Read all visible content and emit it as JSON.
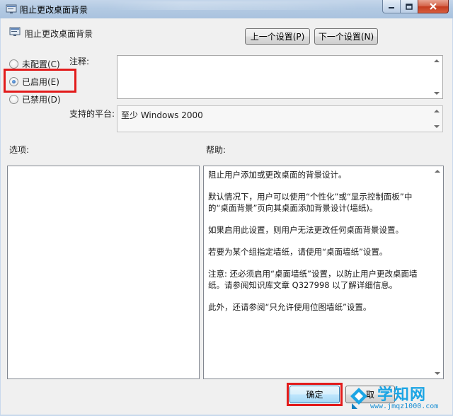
{
  "window": {
    "title": "阻止更改桌面背景",
    "controls": [
      "minimize",
      "maximize",
      "close"
    ]
  },
  "header": {
    "setting_name": "阻止更改桌面背景",
    "prev_button": "上一个设置(P)",
    "next_button": "下一个设置(N)"
  },
  "state": {
    "options": [
      {
        "label": "未配置(C)",
        "checked": false
      },
      {
        "label": "已启用(E)",
        "checked": true
      },
      {
        "label": "已禁用(D)",
        "checked": false
      }
    ]
  },
  "comment": {
    "label": "注释:",
    "value": ""
  },
  "platform": {
    "label": "支持的平台:",
    "value": "至少 Windows 2000"
  },
  "options_section": {
    "label": "选项:"
  },
  "help_section": {
    "label": "帮助:",
    "paragraphs": [
      "阻止用户添加或更改桌面的背景设计。",
      "默认情况下，用户可以使用“个性化”或“显示控制面板”中的“桌面背景”页向其桌面添加背景设计(墙纸)。",
      "如果启用此设置，则用户无法更改任何桌面背景设置。",
      "若要为某个组指定墙纸，请使用“桌面墙纸”设置。",
      "注意: 还必须启用“桌面墙纸”设置，以防止用户更改桌面墙纸。请参阅知识库文章 Q327998 以了解详细信息。",
      "此外，还请参阅“只允许使用位图墙纸”设置。"
    ]
  },
  "footer": {
    "ok_button": "确定",
    "cancel_button": "取"
  },
  "watermark": {
    "name": "学知网",
    "url": "www.jmqz1000.com"
  },
  "colors": {
    "highlight_box": "#e21b1b",
    "watermark_blue": "#1ca5e4"
  }
}
